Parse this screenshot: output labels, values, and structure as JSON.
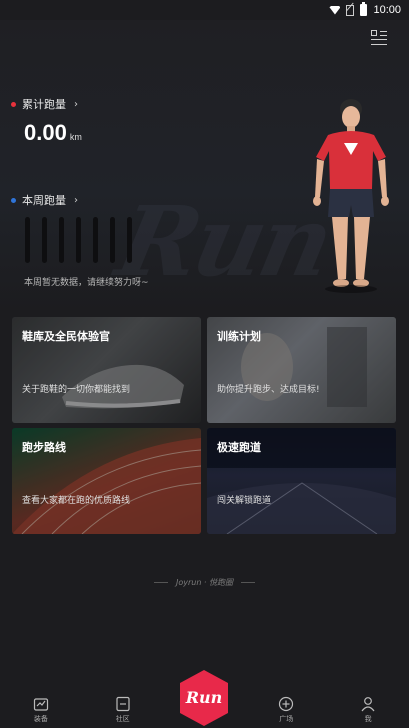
{
  "status_bar": {
    "time": "10:00"
  },
  "hero": {
    "watermark": "Run",
    "total_label": "累计跑量",
    "total_value": "0.00",
    "total_unit": "km",
    "week_label": "本周跑量",
    "week_hint": "本周暂无数据，请继续努力呀~",
    "week_bars": [
      0,
      0,
      0,
      0,
      0,
      0,
      0
    ],
    "colors": {
      "total_dot": "#e8323c",
      "week_dot": "#2f74d8"
    }
  },
  "cards": [
    {
      "title": "鞋库及全民体验官",
      "subtitle": "关于跑鞋的一切你都能找到"
    },
    {
      "title": "训练计划",
      "subtitle": "助你提升跑步、达成目标!"
    },
    {
      "title": "跑步路线",
      "subtitle": "查看大家都在跑的优质路线"
    },
    {
      "title": "极速跑道",
      "subtitle": "闯关解锁跑道"
    }
  ],
  "footer_brand": "Joyrun · 悦跑圈",
  "tabs": [
    {
      "label": "装备",
      "icon": "equipment-icon"
    },
    {
      "label": "社区",
      "icon": "community-icon"
    },
    {
      "label": "Run",
      "icon": "run-hexagon-icon"
    },
    {
      "label": "广场",
      "icon": "plaza-icon"
    },
    {
      "label": "我",
      "icon": "profile-icon"
    }
  ],
  "accent": "#e8294a"
}
